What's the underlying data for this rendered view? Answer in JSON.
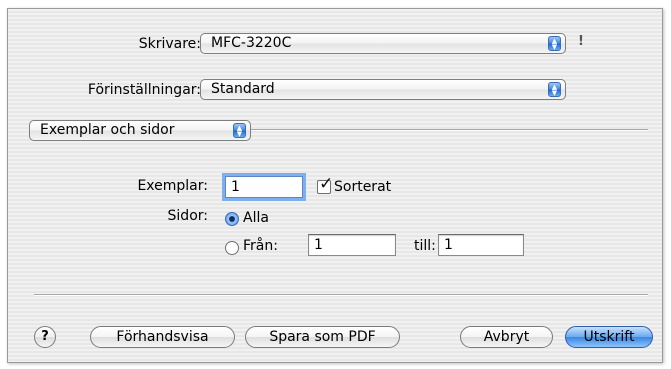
{
  "printer": {
    "label": "Skrivare:",
    "value": "MFC-3220C",
    "status_icon": "!"
  },
  "presets": {
    "label": "Förinställningar:",
    "value": "Standard"
  },
  "section": {
    "value": "Exemplar och sidor"
  },
  "copies": {
    "label": "Exemplar:",
    "value": "1",
    "collate_label": "Sorterat",
    "collate_checked": true
  },
  "pages": {
    "label": "Sidor:",
    "all_label": "Alla",
    "from_label": "Från:",
    "from_value": "1",
    "to_label": "till:",
    "to_value": "1",
    "selected": "all"
  },
  "buttons": {
    "help": "?",
    "preview": "Förhandsvisa",
    "save_pdf": "Spara som PDF",
    "cancel": "Avbryt",
    "print": "Utskrift"
  }
}
